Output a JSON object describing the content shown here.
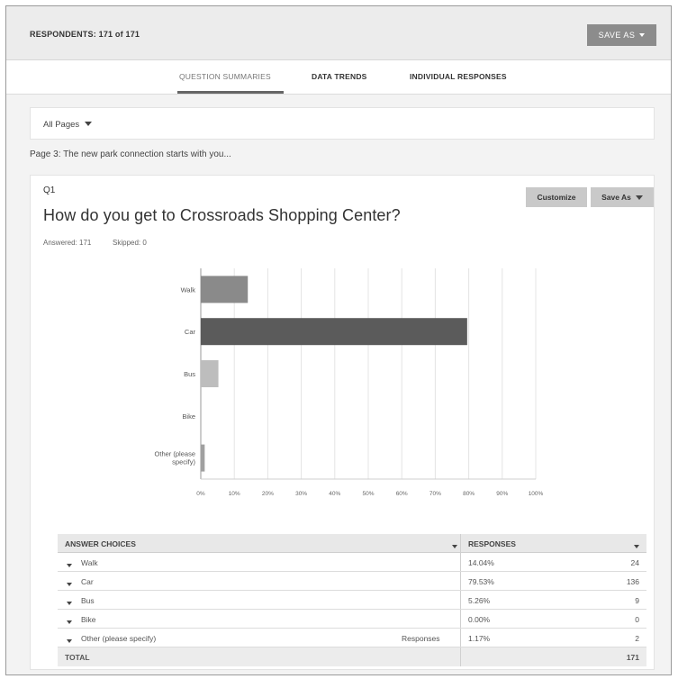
{
  "header": {
    "respondents": "RESPONDENTS: 171 of 171",
    "save_as": "SAVE AS"
  },
  "tabs": [
    {
      "label": "QUESTION SUMMARIES",
      "active": true
    },
    {
      "label": "DATA TRENDS",
      "active": false
    },
    {
      "label": "INDIVIDUAL RESPONSES",
      "active": false
    }
  ],
  "filter": {
    "pages_label": "All Pages"
  },
  "page_caption": "Page 3: The new park connection starts with you...",
  "question": {
    "number": "Q1",
    "title": "How do you get to Crossroads Shopping Center?",
    "answered": "Answered: 171",
    "skipped": "Skipped: 0",
    "customize_label": "Customize",
    "save_as_label": "Save As"
  },
  "chart_data": {
    "type": "bar",
    "orientation": "horizontal",
    "categories": [
      "Walk",
      "Car",
      "Bus",
      "Bike",
      "Other (please specify)"
    ],
    "values": [
      14.04,
      79.53,
      5.26,
      0.0,
      1.17
    ],
    "colors": [
      "#8a8a8a",
      "#5b5b5b",
      "#bdbdbd",
      "#d0d0d0",
      "#a0a0a0"
    ],
    "xlim": [
      0,
      100
    ],
    "x_ticks": [
      "0%",
      "10%",
      "20%",
      "30%",
      "40%",
      "50%",
      "60%",
      "70%",
      "80%",
      "90%",
      "100%"
    ],
    "grid": true
  },
  "table": {
    "headers": {
      "choices": "ANSWER CHOICES",
      "responses": "RESPONSES"
    },
    "rows": [
      {
        "choice": "Walk",
        "extra": "",
        "percent": "14.04%",
        "count": "24"
      },
      {
        "choice": "Car",
        "extra": "",
        "percent": "79.53%",
        "count": "136"
      },
      {
        "choice": "Bus",
        "extra": "",
        "percent": "5.26%",
        "count": "9"
      },
      {
        "choice": "Bike",
        "extra": "",
        "percent": "0.00%",
        "count": "0"
      },
      {
        "choice": "Other (please specify)",
        "extra": "Responses",
        "percent": "1.17%",
        "count": "2"
      }
    ],
    "total_label": "TOTAL",
    "total_count": "171"
  }
}
